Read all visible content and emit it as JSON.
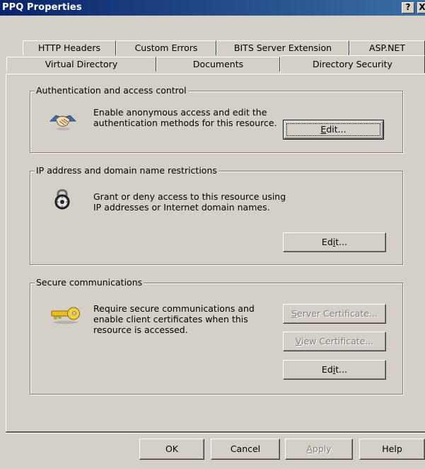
{
  "window": {
    "title": "PPQ Properties",
    "help_btn": "?",
    "close_btn": "X"
  },
  "tabs": {
    "row1": [
      "HTTP Headers",
      "Custom Errors",
      "BITS Server Extension",
      "ASP.NET"
    ],
    "row2": [
      "Virtual Directory",
      "Documents",
      "Directory Security"
    ],
    "active": "Directory Security"
  },
  "auth_group": {
    "label": "Authentication and access control",
    "line1": "Enable anonymous access and edit the",
    "line2": "authentication methods for this resource.",
    "icon": "handshake-icon",
    "edit": {
      "pre": "",
      "mnemonic": "E",
      "post": "dit..."
    }
  },
  "ip_group": {
    "label": "IP address and domain name restrictions",
    "line1": "Grant or deny access to this resource using",
    "line2": "IP addresses or Internet domain names.",
    "icon": "padlock-icon",
    "edit": {
      "pre": "Ed",
      "mnemonic": "i",
      "post": "t..."
    }
  },
  "secure_group": {
    "label": "Secure communications",
    "line1": "Require secure communications and",
    "line2": "enable client certificates when this",
    "line3": "resource is accessed.",
    "icon": "key-icon",
    "server_cert": {
      "pre": "",
      "mnemonic": "S",
      "post": "erver Certificate..."
    },
    "view_cert": {
      "pre": "",
      "mnemonic": "V",
      "post": "iew Certificate..."
    },
    "edit": {
      "pre": "Ed",
      "mnemonic": "i",
      "post": "t..."
    }
  },
  "footer": {
    "ok": "OK",
    "cancel": "Cancel",
    "apply": {
      "pre": "",
      "mnemonic": "A",
      "post": "pply"
    },
    "help": "Help"
  },
  "colors": {
    "face": "#d4d0c8",
    "title_start": "#0a246a",
    "title_end": "#3a6ea5",
    "disabled_text": "#808080"
  }
}
